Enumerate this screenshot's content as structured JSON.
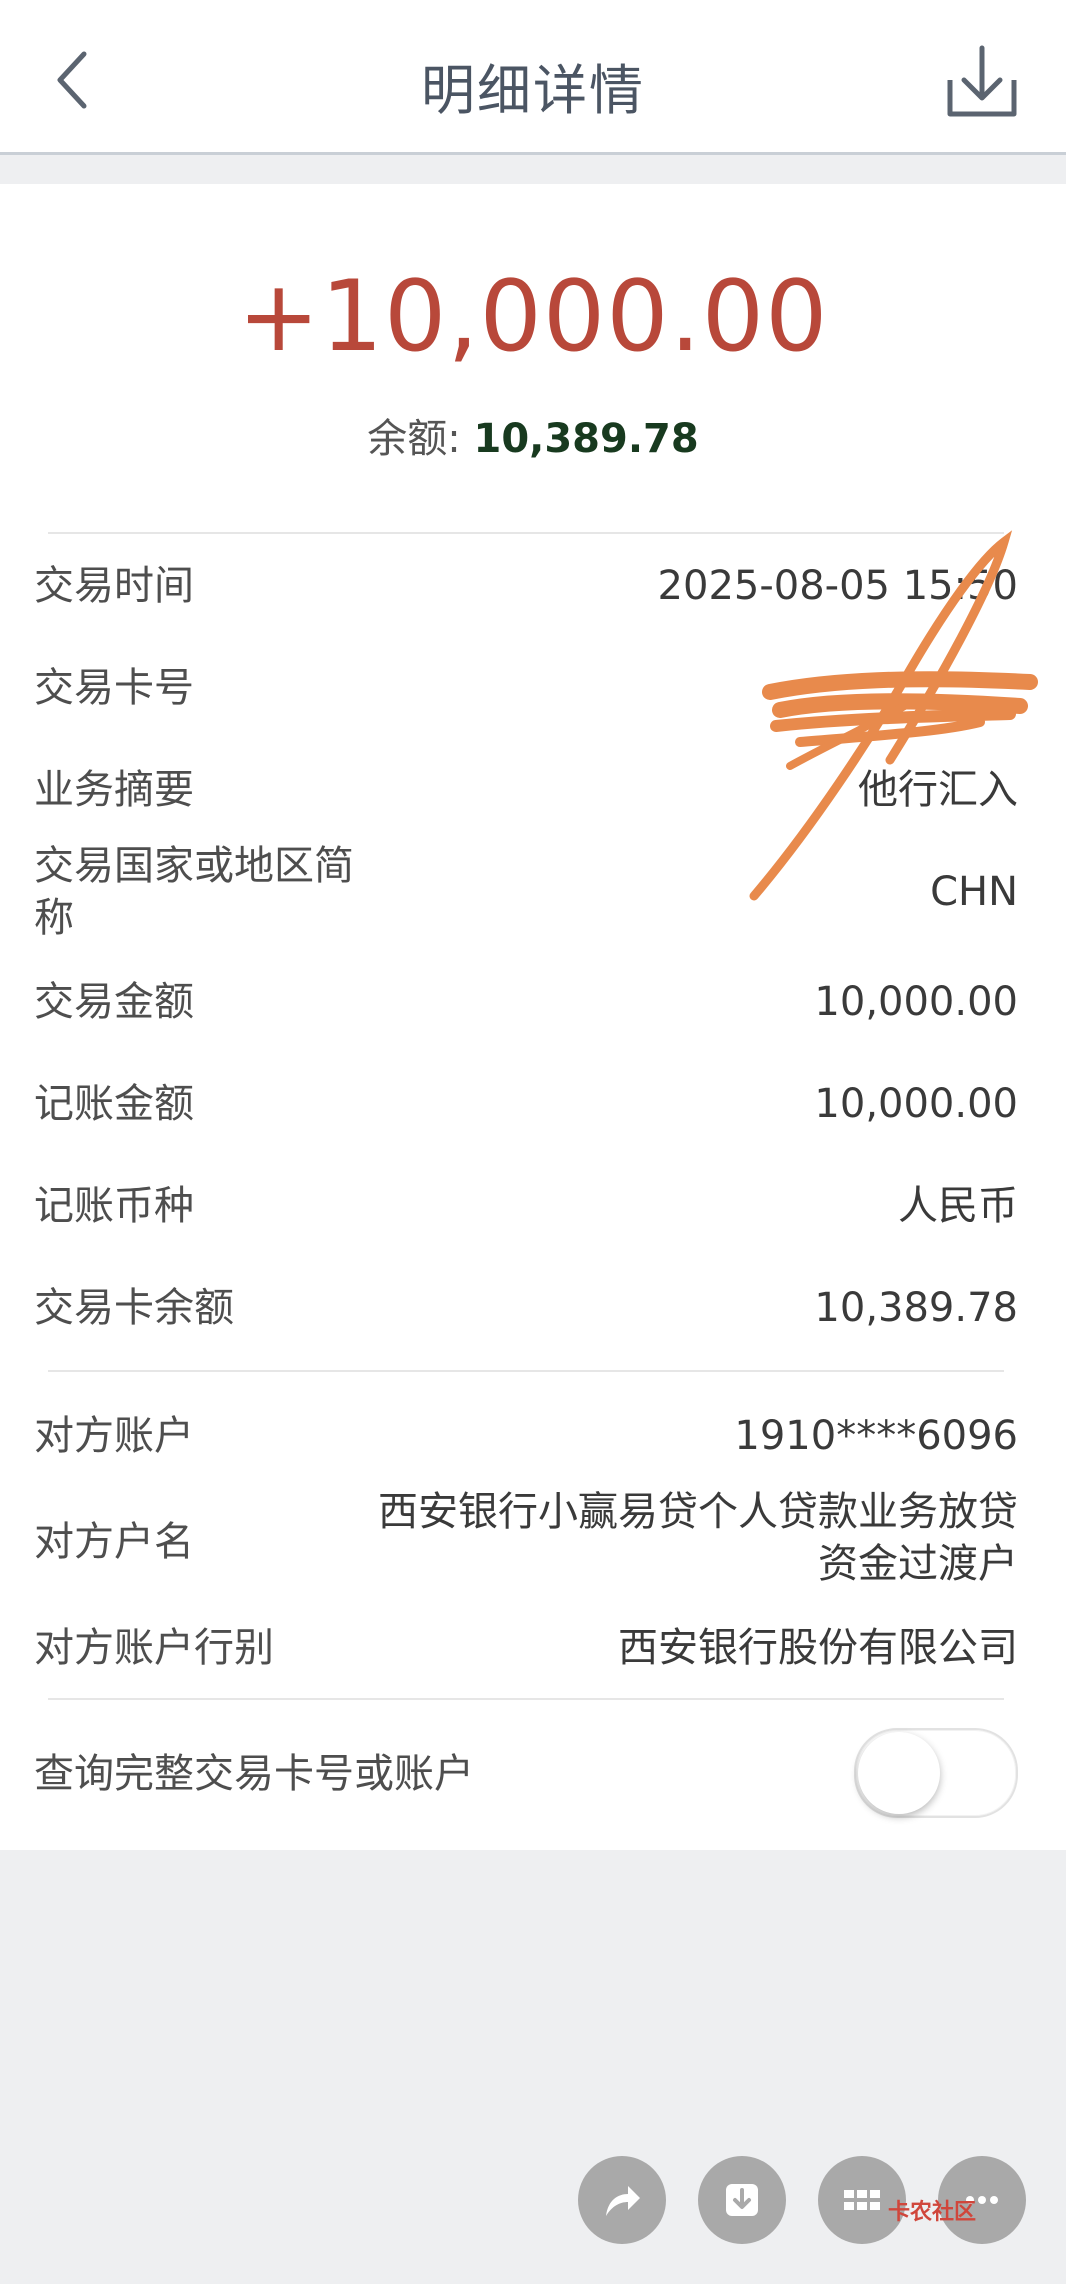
{
  "header": {
    "title": "明细详情"
  },
  "summary": {
    "amount": "+10,000.00",
    "balance_label": "余额:",
    "balance_value": "10,389.78"
  },
  "details": [
    {
      "key": "交易时间",
      "value": "2025-08-05 15:50"
    },
    {
      "key": "交易卡号",
      "value": ""
    },
    {
      "key": "业务摘要",
      "value": "他行汇入"
    },
    {
      "key": "交易国家或地区简称",
      "value": "CHN"
    },
    {
      "key": "交易金额",
      "value": "10,000.00"
    },
    {
      "key": "记账金额",
      "value": "10,000.00"
    },
    {
      "key": "记账币种",
      "value": "人民币"
    },
    {
      "key": "交易卡余额",
      "value": "10,389.78"
    }
  ],
  "counterparty": [
    {
      "key": "对方账户",
      "value": "1910****6096"
    },
    {
      "key": "对方户名",
      "value": "西安银行小赢易贷个人贷款业务放贷资金过渡户"
    },
    {
      "key": "对方账户行别",
      "value": "西安银行股份有限公司"
    }
  ],
  "toggle": {
    "label": "查询完整交易卡号或账户",
    "on": false
  },
  "colors": {
    "amount": "#b8483a",
    "balance_value": "#183a1f",
    "background": "#eeeff1"
  },
  "watermark": {
    "text": "卡农社区"
  }
}
